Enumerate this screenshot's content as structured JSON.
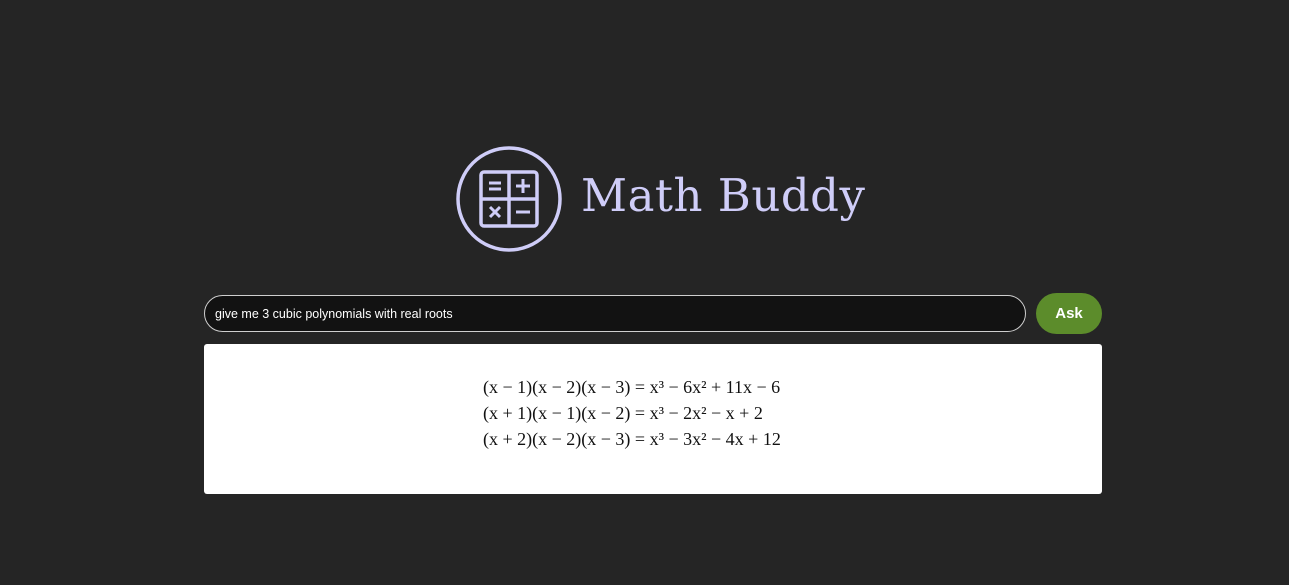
{
  "header": {
    "logo_icon": "calculator-icon",
    "title": "Math Buddy",
    "accent_color": "#cfcdf8"
  },
  "search": {
    "value": "give me 3 cubic polynomials with real roots"
  },
  "ask_button": {
    "label": "Ask",
    "color": "#5c8c2b"
  },
  "answer": {
    "equations": [
      "(x − 1)(x − 2)(x − 3) = x³ − 6x² + 11x − 6",
      "(x + 1)(x − 1)(x − 2) = x³ − 2x² − x + 2",
      "(x + 2)(x − 2)(x − 3) = x³ − 3x² − 4x + 12"
    ]
  }
}
